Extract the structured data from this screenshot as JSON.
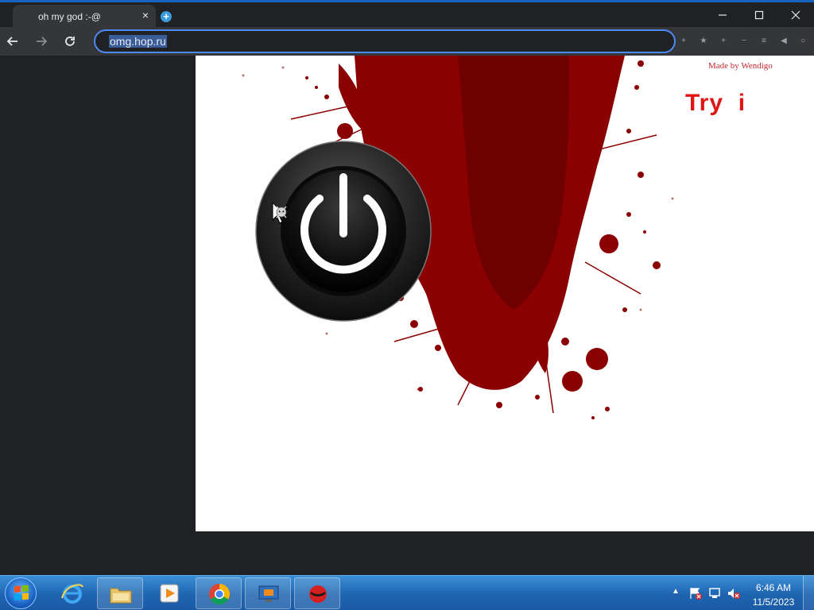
{
  "browser": {
    "tab": {
      "title": "oh my god :-@",
      "close_glyph": "×"
    },
    "new_tab_glyph": "+",
    "address": "omg.hop.ru",
    "toolbar_icons": [
      "+",
      "★",
      "+",
      "−",
      "≡",
      "◀",
      "○"
    ]
  },
  "page": {
    "credit": "Made by Wendigo",
    "headline": "Try  i",
    "colors": {
      "blood": "#8b0000",
      "headline": "#e01515",
      "credit": "#c0282d"
    },
    "icons": [
      "blood-splatter-image",
      "power-button-icon",
      "skull-cursor-icon"
    ]
  },
  "taskbar": {
    "items": [
      "start-orb-icon",
      "internet-explorer-icon",
      "file-explorer-icon",
      "media-player-icon",
      "chrome-icon",
      "remote-desktop-icon",
      "malware-app-icon"
    ],
    "tray": {
      "chevron": "▲",
      "time": "6:46 AM",
      "date": "11/5/2023"
    }
  }
}
